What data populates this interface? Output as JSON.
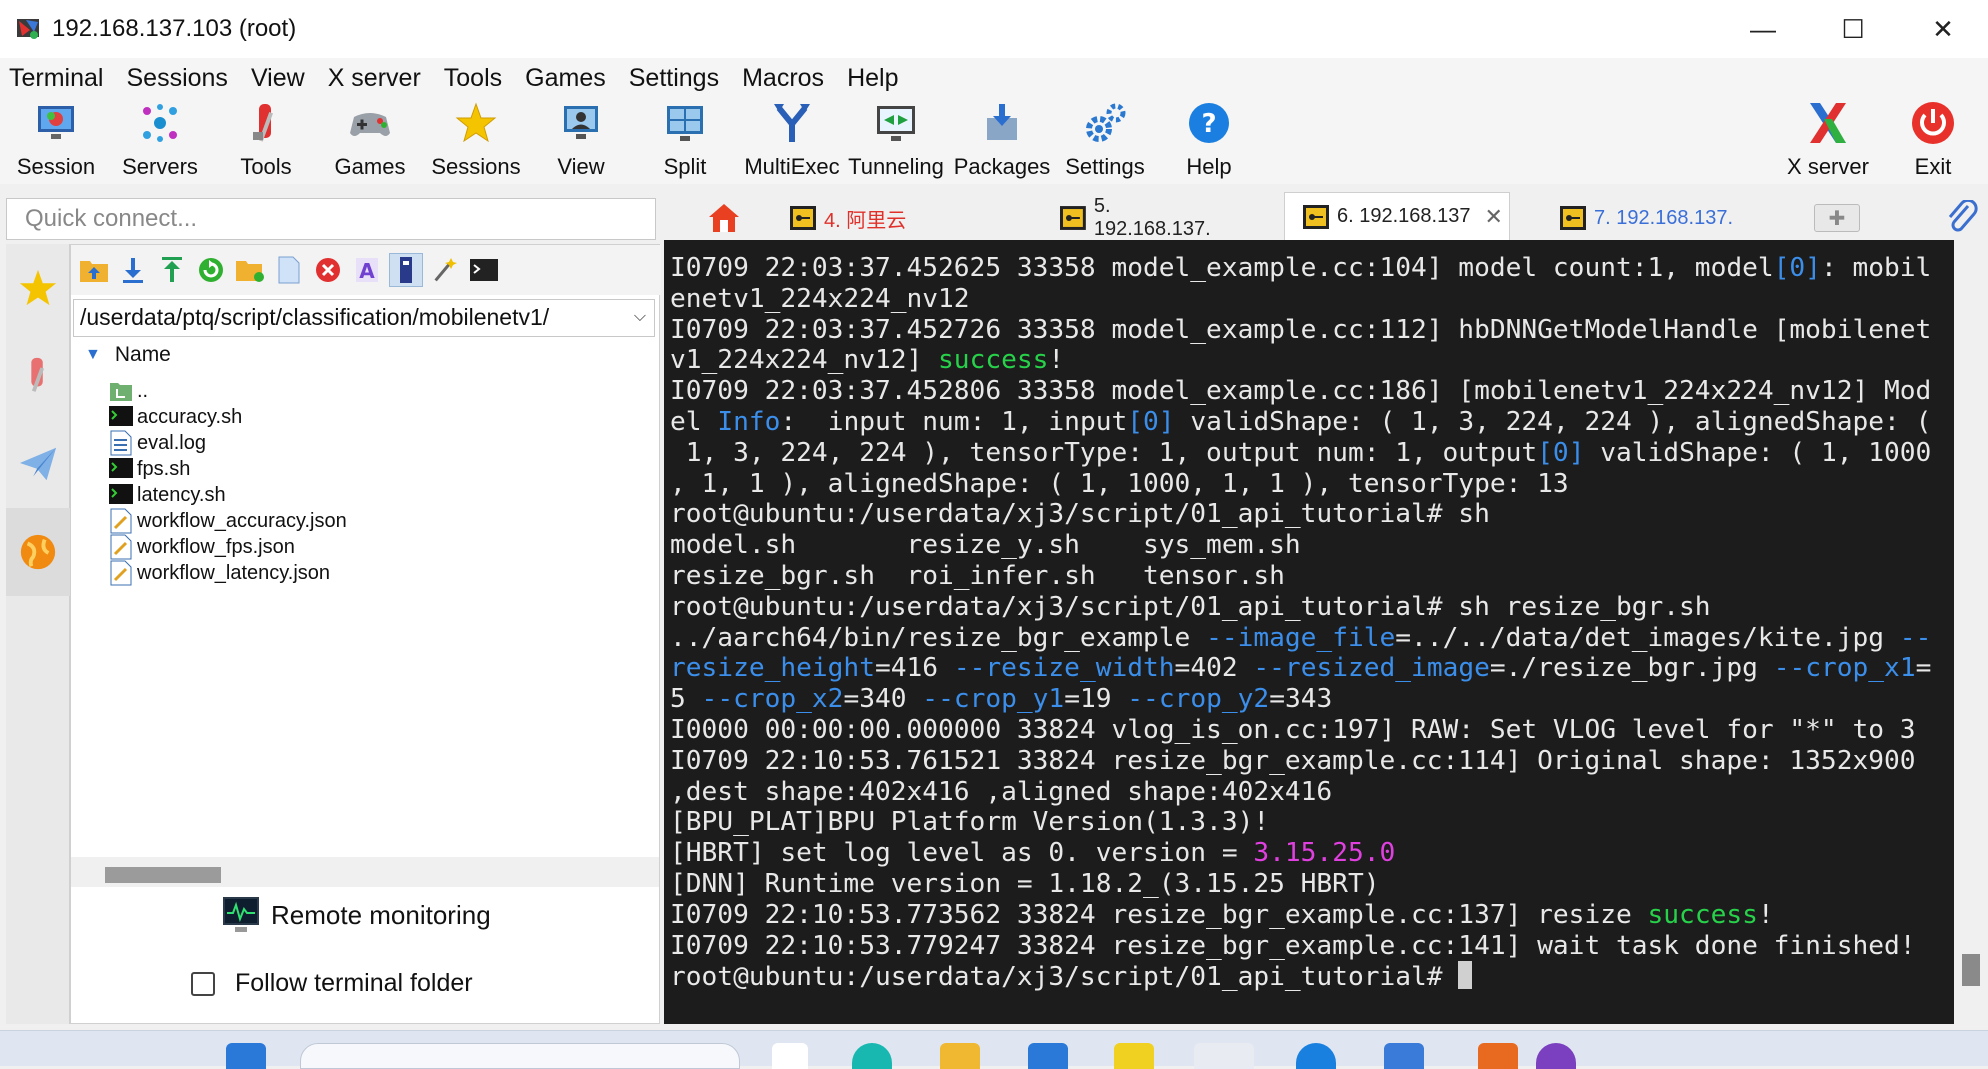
{
  "window": {
    "title": "192.168.137.103 (root)",
    "min": "—",
    "max": "☐",
    "close": "✕"
  },
  "menu": [
    "Terminal",
    "Sessions",
    "View",
    "X server",
    "Tools",
    "Games",
    "Settings",
    "Macros",
    "Help"
  ],
  "toolbar": {
    "session": "Session",
    "servers": "Servers",
    "tools": "Tools",
    "games": "Games",
    "sessions": "Sessions",
    "view": "View",
    "split": "Split",
    "multiexec": "MultiExec",
    "tunneling": "Tunneling",
    "packages": "Packages",
    "settings": "Settings",
    "help": "Help",
    "xserver": "X server",
    "exit": "Exit"
  },
  "quick_connect": {
    "placeholder": "Quick connect..."
  },
  "sftp": {
    "path": "/userdata/ptq/script/classification/mobilenetv1/",
    "column_name": "Name",
    "files": [
      "..",
      "accuracy.sh",
      "eval.log",
      "fps.sh",
      "latency.sh",
      "workflow_accuracy.json",
      "workflow_fps.json",
      "workflow_latency.json"
    ],
    "remote_monitoring": "Remote monitoring",
    "follow_folder": "Follow terminal folder"
  },
  "tabs": [
    {
      "label": "4. 阿里云",
      "color": "#e0302a"
    },
    {
      "label": "5. 192.168.137.",
      "color": "#222222"
    },
    {
      "label": "6. 192.168.137",
      "color": "#222222",
      "close": "✕"
    },
    {
      "label": "7. 192.168.137.",
      "color": "#3a6fd8"
    }
  ],
  "terminal": {
    "l1": "I0709 22:03:37.452625 33358 model_example.cc:104] model count:1, model",
    "l1b": "[0]",
    "l1c": ": mobil",
    "l2": "enetv1_224x224_nv12",
    "l3": "I0709 22:03:37.452726 33358 model_example.cc:112] hbDNNGetModelHandle [mobilenet",
    "l4a": "v1_224x224_nv12] ",
    "l4b": "success",
    "l4c": "!",
    "l5": "I0709 22:03:37.452806 33358 model_example.cc:186] [mobilenetv1_224x224_nv12] Mod",
    "l6a": "el ",
    "l6b": "Info",
    "l6c": ":  input num: 1, input",
    "l6d": "[0]",
    "l6e": " validShape: ( 1, 3, 224, 224 ), alignedShape: (",
    "l7a": " 1, 3, 224, 224 ), tensorType: 1, output num: 1, output",
    "l7b": "[0]",
    "l7c": " validShape: ( 1, 1000",
    "l8": ", 1, 1 ), alignedShape: ( 1, 1000, 1, 1 ), tensorType: 13",
    "l9": "root@ubuntu:/userdata/xj3/script/01_api_tutorial# sh",
    "l10": "model.sh       resize_y.sh    sys_mem.sh",
    "l11": "resize_bgr.sh  roi_infer.sh   tensor.sh",
    "l12": "root@ubuntu:/userdata/xj3/script/01_api_tutorial# sh resize_bgr.sh",
    "l13a": "../aarch64/bin/resize_bgr_example ",
    "l13b": "--image_file",
    "l13c": "=../../data/det_images/kite.jpg ",
    "l13d": "--",
    "l14a": "resize_height",
    "l14b": "=416 ",
    "l14c": "--resize_width",
    "l14d": "=402 ",
    "l14e": "--resized_image",
    "l14f": "=./resize_bgr.jpg ",
    "l14g": "--crop_x1",
    "l14h": "=",
    "l15a": "5 ",
    "l15b": "--crop_x2",
    "l15c": "=340 ",
    "l15d": "--crop_y1",
    "l15e": "=19 ",
    "l15f": "--crop_y2",
    "l15g": "=343",
    "l16": "I0000 00:00:00.000000 33824 vlog_is_on.cc:197] RAW: Set VLOG level for \"*\" to 3",
    "l17": "I0709 22:10:53.761521 33824 resize_bgr_example.cc:114] Original shape: 1352x900",
    "l18": ",dest shape:402x416 ,aligned shape:402x416",
    "l19": "[BPU_PLAT]BPU Platform Version(1.3.3)!",
    "l20a": "[HBRT] set log level as 0. version = ",
    "l20b": "3.15.25.0",
    "l21": "[DNN] Runtime version = 1.18.2_(3.15.25 HBRT)",
    "l22a": "I0709 22:10:53.773562 33824 resize_bgr_example.cc:137] resize ",
    "l22b": "success",
    "l22c": "!",
    "l23": "I0709 22:10:53.779247 33824 resize_bgr_example.cc:141] wait task done finished!",
    "l24": "root@ubuntu:/userdata/xj3/script/01_api_tutorial# "
  }
}
